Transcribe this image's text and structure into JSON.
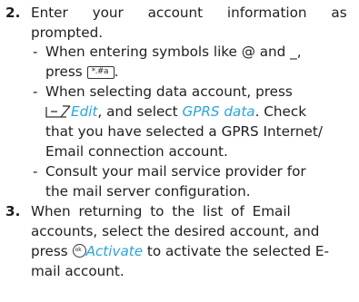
{
  "step2": {
    "number": "2.",
    "line1": "Enter your account information as",
    "line2": "prompted.",
    "bullets": [
      {
        "a": "When entering symbols like @ and _,",
        "b_pre": "press",
        "b_post": ".",
        "key_label": "*.#a"
      },
      {
        "a": "When selecting data account, press",
        "b_edit": "Edit",
        "b_mid": ", and select",
        "b_gprs": "GPRS data",
        "b_end": ". Check",
        "c": "that you have selected a GPRS Internet/",
        "d": "Email connection account."
      },
      {
        "a": "Consult your mail service provider for",
        "b": "the mail server configuration."
      }
    ]
  },
  "step3": {
    "number": "3.",
    "line1": "When returning to the list of Email",
    "line2": "accounts, select the desired account, and",
    "line3_pre": "press",
    "line3_activate": "Activate",
    "line3_post": "to activate the selected E-",
    "line4": "mail account.",
    "ok_label": "ok"
  },
  "icons": {
    "star_key": "star-hash-key-icon",
    "softkey": "left-softkey-icon",
    "ok_key": "ok-key-icon"
  },
  "colors": {
    "text": "#1f1f1f",
    "accent": "#2aa6d8"
  }
}
